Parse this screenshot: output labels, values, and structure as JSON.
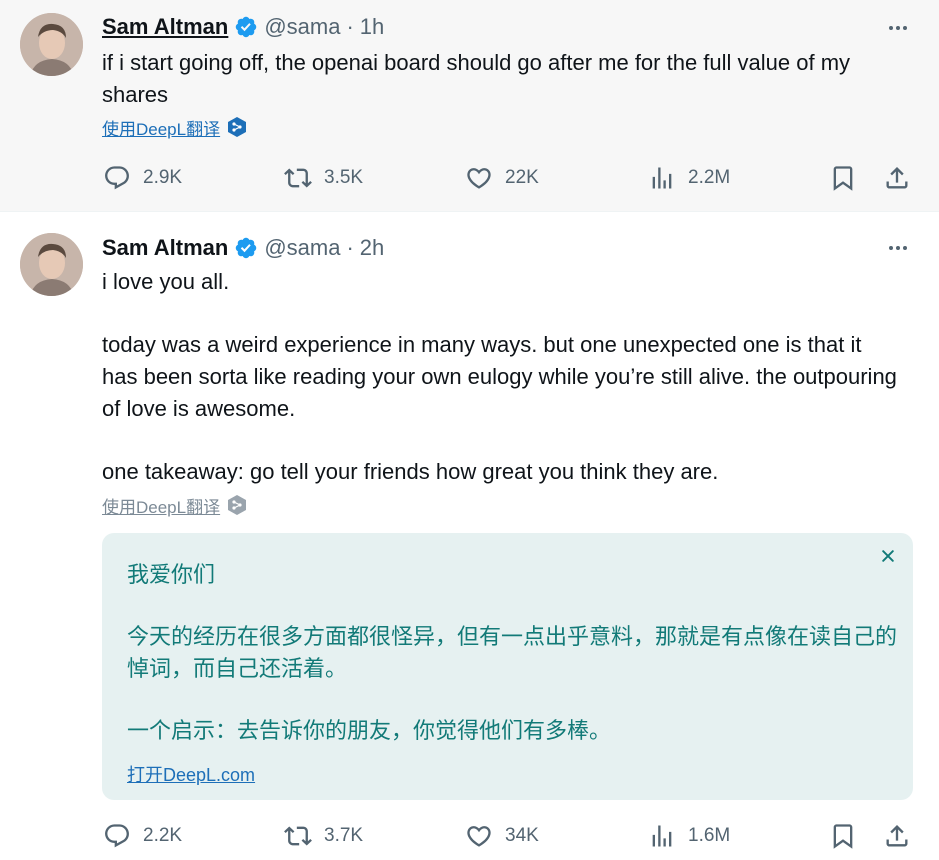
{
  "tweets": [
    {
      "author": {
        "name": "Sam Altman",
        "handle": "@sama",
        "verified": true
      },
      "separator": "·",
      "time": "1h",
      "paragraphs": [
        "if i start going off, the openai board should go after me for the full value of my shares"
      ],
      "translate_link": "使用DeepL翻译",
      "stats": {
        "replies": "2.9K",
        "retweets": "3.5K",
        "likes": "22K",
        "views": "2.2M"
      }
    },
    {
      "author": {
        "name": "Sam Altman",
        "handle": "@sama",
        "verified": true
      },
      "separator": "·",
      "time": "2h",
      "paragraphs": [
        "i love you all.",
        "today was a weird experience in many ways. but one unexpected one is that it has been sorta like reading your own eulogy while you’re still alive. the outpouring of love is awesome.",
        "one takeaway: go tell your friends how great you think they are."
      ],
      "translate_link": "使用DeepL翻译",
      "translation": {
        "paragraphs": [
          "我爱你们",
          "今天的经历在很多方面都很怪异，但有一点出乎意料，那就是有点像在读自己的悼词，而自己还活着。",
          "一个启示：去告诉你的朋友，你觉得他们有多棒。"
        ],
        "open_link": "打开DeepL.com"
      },
      "stats": {
        "replies": "2.2K",
        "retweets": "3.7K",
        "likes": "34K",
        "views": "1.6M"
      }
    }
  ],
  "icons": {
    "verified": "verified-badge-icon",
    "more": "more-horizontal-icon",
    "reply": "reply-bubble-icon",
    "retweet": "retweet-icon",
    "like": "heart-icon",
    "views": "bar-chart-icon",
    "bookmark": "bookmark-icon",
    "share": "share-upload-icon",
    "deepl": "deepl-logo-icon",
    "close": "close-icon"
  },
  "colors": {
    "text": "#0f1419",
    "muted": "#536471",
    "verified": "#1d9bf0",
    "link": "#1d6fb8",
    "translation_bg": "#e6f1f1",
    "translation_text": "#127a78",
    "first_tweet_bg": "#f7f7f7"
  }
}
